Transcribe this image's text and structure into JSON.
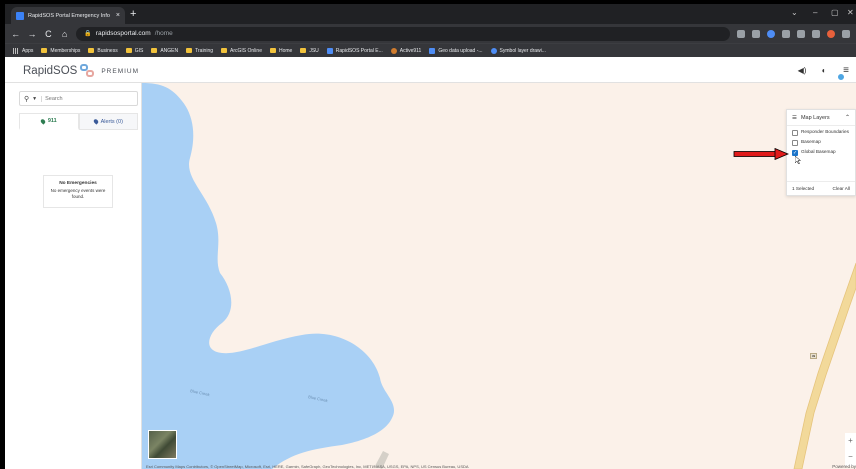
{
  "browser": {
    "tab_title": "RapidSOS Portal Emergency Info",
    "url_host": "rapidsosportal.com",
    "url_path": "/home",
    "bookmarks": [
      "Apps",
      "Memberships",
      "Business",
      "GIS",
      "ANGEN",
      "Training",
      "ArcGIS Online",
      "Home",
      "JSU",
      "RapidSOS Portal E...",
      "Active911",
      "Geo data upload -...",
      "Symbol layer drawi..."
    ]
  },
  "app": {
    "brand": "RapidSOS",
    "brand_suffix": "PREMIUM"
  },
  "sidebar": {
    "search_placeholder": "Search",
    "tabs": [
      {
        "label": "911",
        "color": "#2e7d52"
      },
      {
        "label": "Alerts (0)",
        "color": "#3b5b99"
      }
    ],
    "empty_title": "No Emergencies",
    "empty_body": "No emergency events were found."
  },
  "map": {
    "water_color": "#a9d0f5",
    "land_color": "#fbf1e9",
    "road_color": "#f2d99a",
    "creek_labels": [
      "Blue Creek",
      "Blue Creek"
    ],
    "road_shield": "49",
    "attribution": "Esri Community Maps Contributors, © OpenStreetMap, Microsoft, Esri, HERE, Garmin, SafeGraph, GeoTechnologies, Inc, METI/NASA, USGS, EPA, NPS, US Census Bureau, USDA",
    "powered_by": "Powered by",
    "zoom_in": "+",
    "zoom_out": "−"
  },
  "layers_panel": {
    "title": "Map Layers",
    "items": [
      {
        "label": "Responder Boundaries",
        "checked": false
      },
      {
        "label": "Basemap",
        "checked": false
      },
      {
        "label": "Global Basemap",
        "checked": true
      }
    ],
    "selected_count": "1 Selected",
    "clear_all": "Clear All"
  }
}
